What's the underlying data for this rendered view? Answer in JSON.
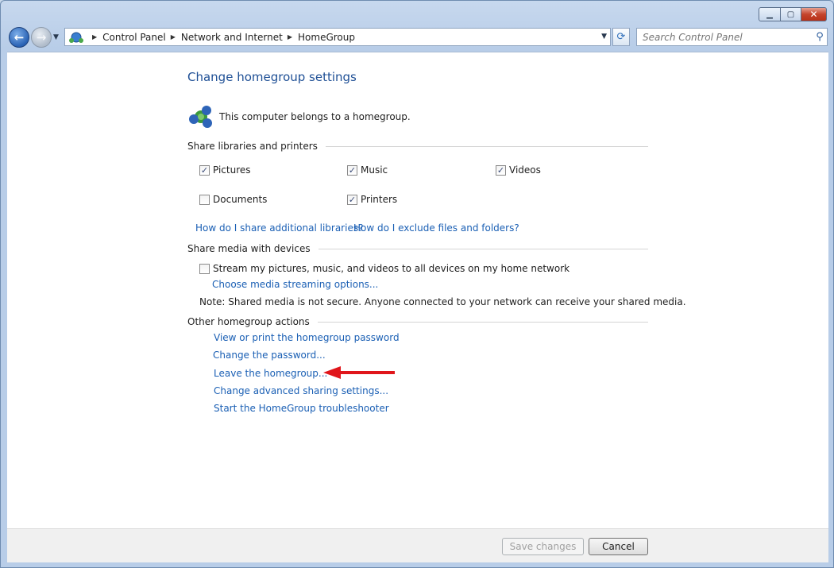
{
  "window": {
    "minimize_glyph": "▁",
    "maximize_glyph": "▢",
    "close_glyph": "✕"
  },
  "nav": {
    "back_glyph": "←",
    "forward_glyph": "→",
    "breadcrumb": [
      "Control Panel",
      "Network and Internet",
      "HomeGroup"
    ],
    "search_placeholder": "Search Control Panel"
  },
  "page": {
    "title": "Change homegroup settings",
    "belongs_text": "This computer belongs to a homegroup."
  },
  "libraries": {
    "heading": "Share libraries and printers",
    "items": [
      {
        "label": "Pictures",
        "checked": true
      },
      {
        "label": "Music",
        "checked": true
      },
      {
        "label": "Videos",
        "checked": true
      },
      {
        "label": "Documents",
        "checked": false
      },
      {
        "label": "Printers",
        "checked": true
      }
    ],
    "link_share_more": "How do I share additional libraries?",
    "link_exclude": "How do I exclude files and folders?"
  },
  "media": {
    "heading": "Share media with devices",
    "stream_label": "Stream my pictures, music, and videos to all devices on my home network",
    "stream_checked": false,
    "options_link": "Choose media streaming options...",
    "note": "Note: Shared media is not secure. Anyone connected to your network can receive your shared media."
  },
  "other": {
    "heading": "Other homegroup actions",
    "links": [
      "View or print the homegroup password",
      "Change the password...",
      "Leave the homegroup...",
      "Change advanced sharing settings...",
      "Start the HomeGroup troubleshooter"
    ]
  },
  "annotation": {
    "arrow_color": "#e0161b"
  },
  "footer": {
    "save_label": "Save changes",
    "cancel_label": "Cancel"
  },
  "colors": {
    "link": "#1a5fb4",
    "title": "#1e4f95"
  }
}
